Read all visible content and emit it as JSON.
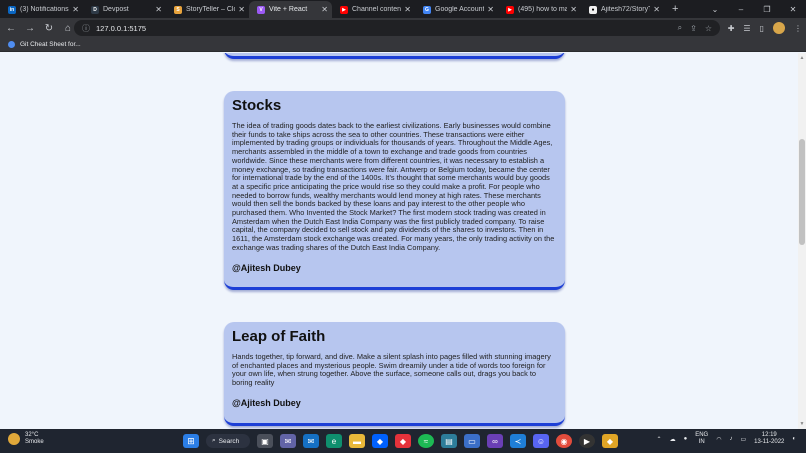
{
  "browser": {
    "tabs": [
      {
        "title": "(3) Notifications |",
        "icon": "linkedin-icon",
        "color": "#0a66c2",
        "glyph": "in",
        "active": false
      },
      {
        "title": "Devpost",
        "icon": "devpost-icon",
        "color": "#2f3b48",
        "glyph": "D",
        "active": false
      },
      {
        "title": "StoryTeller – Clou",
        "icon": "storyteller-icon",
        "color": "#e8a33c",
        "glyph": "S",
        "active": false
      },
      {
        "title": "Vite + React",
        "icon": "vite-icon",
        "color": "#9b59f5",
        "glyph": "V",
        "active": true
      },
      {
        "title": "Channel content",
        "icon": "youtube-icon",
        "color": "#ff0000",
        "glyph": "▶",
        "active": false
      },
      {
        "title": "Google Account",
        "icon": "google-icon",
        "color": "#4285f4",
        "glyph": "G",
        "active": false
      },
      {
        "title": "(495) how to mak",
        "icon": "youtube-icon",
        "color": "#ff0000",
        "glyph": "▶",
        "active": false
      },
      {
        "title": "Ajitesh72/StoryTe",
        "icon": "github-icon",
        "color": "#f0f0f0",
        "glyph": "●",
        "active": false
      }
    ],
    "newtab_glyph": "+",
    "address": "127.0.0.1:5175",
    "bookmark": "Git Cheat Sheet for..."
  },
  "stories": [
    {
      "title": "Stocks",
      "body": "The idea of trading goods dates back to the earliest civilizations. Early businesses would combine their funds to take ships across the sea to other countries. These transactions were either implemented by trading groups or individuals for thousands of years. Throughout the Middle Ages, merchants assembled in the middle of a town to exchange and trade goods from countries worldwide. Since these merchants were from different countries, it was necessary to establish a money exchange, so trading transactions were fair. Antwerp or Belgium today, became the center for international trade by the end of the 1400s. It’s thought that some merchants would buy goods at a specific price anticipating the price would rise so they could make a profit. For people who needed to borrow funds, wealthy merchants would lend money at high rates. These merchants would then sell the bonds backed by these loans and pay interest to the other people who purchased them. Who Invented the Stock Market? The first modern stock trading was created in Amsterdam when the Dutch East India Company was the first publicly traded company. To raise capital, the company decided to sell stock and pay dividends of the shares to investors. Then in 1611, the Amsterdam stock exchange was created. For many years, the only trading activity on the exchange was trading shares of the Dutch East India Company.",
      "author": "@Ajitesh Dubey"
    },
    {
      "title": "Leap of Faith",
      "body": "Hands together, tip forward, and dive. Make a silent splash into pages filled with stunning imagery of enchanted places and mysterious people. Swim dreamily under a tide of words too foreign for your own life, when strung together. Above the surface, someone calls out, drags you back to boring reality",
      "author": "@Ajitesh Dubey"
    }
  ],
  "taskbar": {
    "temperature": "32°C",
    "condition": "Smoke",
    "search_label": "Search",
    "lang_line1": "ENG",
    "lang_line2": "IN",
    "time": "12:19",
    "date": "13-11-2022"
  }
}
